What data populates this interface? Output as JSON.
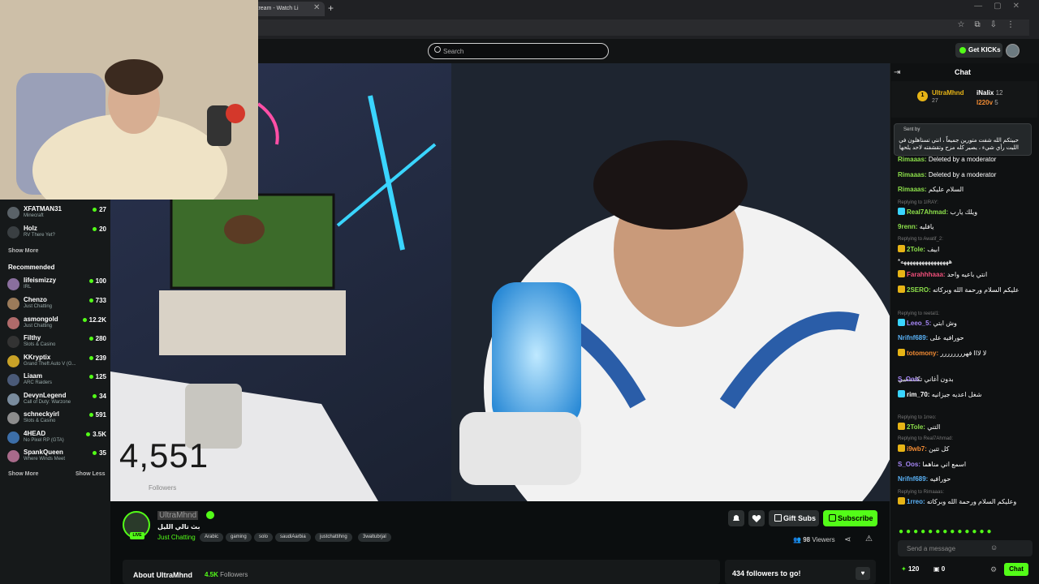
{
  "browser": {
    "tab_title": "d Stream - Watch Li",
    "tab_close": "✕",
    "new_tab": "+"
  },
  "header": {
    "search_placeholder": "Search",
    "get_kicks": "Get KICKs"
  },
  "sidebar": {
    "following": [
      {
        "name": "XFATMAN31",
        "category": "Minecraft",
        "viewers": "27"
      },
      {
        "name": "Holz",
        "category": "RV There Yet?",
        "viewers": "20"
      }
    ],
    "show_more_following": "Show More",
    "recommended_heading": "Recommended",
    "recommended": [
      {
        "name": "lifeismizzy",
        "category": "IRL",
        "viewers": "100"
      },
      {
        "name": "Chenzo",
        "category": "Just Chatting",
        "viewers": "733"
      },
      {
        "name": "asmongold",
        "category": "Just Chatting",
        "viewers": "12.2K"
      },
      {
        "name": "Filthy",
        "category": "Slots & Casino",
        "viewers": "280"
      },
      {
        "name": "KKryptix",
        "category": "Grand Theft Auto V (G...",
        "viewers": "239"
      },
      {
        "name": "Liaam",
        "category": "ARC Raiders",
        "viewers": "125"
      },
      {
        "name": "DevynLegend",
        "category": "Call of Duty: Warzone",
        "viewers": "34"
      },
      {
        "name": "schneckyirl",
        "category": "Slots & Casino",
        "viewers": "591"
      },
      {
        "name": "4HEAD",
        "category": "No Pixel RP (GTA)",
        "viewers": "3.5K"
      },
      {
        "name": "SpankQueen",
        "category": "Where Winds Meet",
        "viewers": "35"
      }
    ],
    "show_more": "Show More",
    "show_less": "Show Less"
  },
  "video": {
    "follower_count": "4,551",
    "follower_word": "Followers"
  },
  "channel": {
    "name": "UltraMhnd",
    "title": "بث تالي الليل",
    "category": "Just Chatting",
    "live": "LIVE",
    "tags": [
      "Arabic",
      "gaming",
      "solo",
      "saudiAarbia",
      "justchattihng",
      "3waltubrjal"
    ],
    "gift_subs": "Gift Subs",
    "subscribe": "Subscribe",
    "viewers_count": "98",
    "viewers_label": "Viewers",
    "about_title": "About UltraMhnd",
    "about_followers_count": "4.5K",
    "about_followers_label": "Followers",
    "goal": "434 followers to go!"
  },
  "chat": {
    "title": "Chat",
    "leaderboard": {
      "first_rank": "1",
      "first_name": "UltraMhnd",
      "first_count": "27",
      "second_name": "iNalix",
      "second_count": "12",
      "third_name": "I220v",
      "third_count": "5"
    },
    "pinned_sent_by": "Sent by",
    "pinned_text": "حبيتكم الله شفت متورين جميعاً ، انتي تستاهلون في الليت رأي شيء ، يصير كله مزح وتقشفته لاحد يلحها",
    "messages": [
      {
        "user": "Rimaaas:",
        "text": "Deleted by a moderator",
        "color": "#8de04b"
      },
      {
        "user": "Rimaaas:",
        "text": "Deleted by a moderator",
        "color": "#8de04b"
      },
      {
        "user": "Rimaaas:",
        "text": "السلام عليكم",
        "color": "#8de04b"
      },
      {
        "reply": "Replying to 1IRAY:"
      },
      {
        "user": "Real7Ahmad:",
        "text": "ويلك يارب",
        "color": "#8de04b"
      },
      {
        "user": "9renn:",
        "text": "يافليه",
        "color": "#8de04b"
      },
      {
        "reply": "Replying to Awatif_2:"
      },
      {
        "user": "2Tole:",
        "text": "ابيف",
        "color": "#8de04b"
      },
      {
        "user": "",
        "text": "*ههههههههههههههههه",
        "color": "#ffffff"
      },
      {
        "user": "Farahhhaaa:",
        "text": "انتي باعيه واحد",
        "color": "#f04f7a"
      },
      {
        "user": "2SERO:",
        "text": "عليكم السلام ورحمة الله وبركاته",
        "color": "#8de04b"
      },
      {
        "reply": "Replying to reetal1:"
      },
      {
        "user": "Leeo_5:",
        "text": "وش ابتي",
        "color": "#a586f5"
      },
      {
        "user": "Nrifnf689:",
        "text": "حورافيه على",
        "color": "#5ab2f7"
      },
      {
        "user": "totomony:",
        "text": "لا لااا فهرررررررر",
        "color": "#f28b33"
      },
      {
        "user": "",
        "text": "بدون أغاني تكلسسي",
        "color": "#ffffff"
      },
      {
        "user": "S_Oos:",
        "text": "",
        "color": "#a586f5"
      },
      {
        "user": "rim_70:",
        "text": "شغل اعديه جيزانيه",
        "color": "#ffffff"
      },
      {
        "reply": "Replying to 1rreo:"
      },
      {
        "user": "2Tole:",
        "text": "التني",
        "color": "#8de04b"
      },
      {
        "reply": "Replying to Real7Ahmad:"
      },
      {
        "user": "i9wb7:",
        "text": "كل تتين",
        "color": "#f28b33"
      },
      {
        "user": "S_Oos:",
        "text": "اسمع اني مناهما",
        "color": "#a586f5"
      },
      {
        "user": "Nrifnf689:",
        "text": "حورافيه",
        "color": "#5ab2f7"
      },
      {
        "reply": "Replying to Rimaaas:"
      },
      {
        "user": "1rreo:",
        "text": "وعليكم السلام ورحمة الله وبركاته",
        "color": "#5ab2f7"
      }
    ],
    "input_placeholder": "Send a message",
    "points": "120",
    "gifts": "0",
    "send_label": "Chat"
  }
}
